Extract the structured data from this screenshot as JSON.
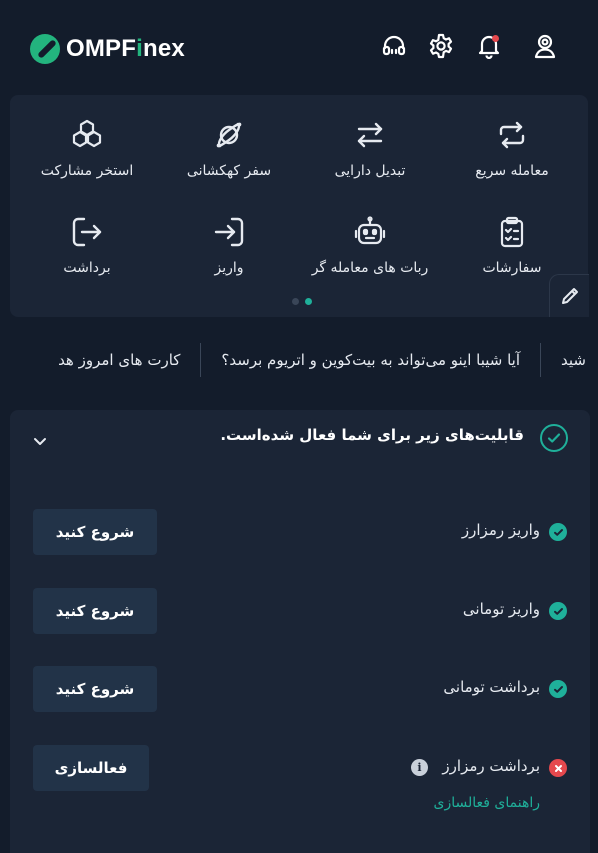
{
  "brand": {
    "name_main": "OMPF",
    "name_accent": "i",
    "name_tail": "nex",
    "accent_color": "#23b47e"
  },
  "header_icons": [
    "support-headset-icon",
    "settings-gear-icon",
    "notification-bell-icon",
    "user-profile-icon"
  ],
  "quick_actions": [
    {
      "label": "معامله سریع",
      "icon": "quick-trade-icon"
    },
    {
      "label": "تبدیل دارایی",
      "icon": "asset-convert-icon"
    },
    {
      "label": "سفر کهکشانی",
      "icon": "planet-icon"
    },
    {
      "label": "استخر مشارکت",
      "icon": "pool-cubes-icon"
    },
    {
      "label": "سفارشات",
      "icon": "orders-clipboard-icon"
    },
    {
      "label": "ربات های معامله گر",
      "icon": "robot-icon"
    },
    {
      "label": "واریز",
      "icon": "deposit-icon"
    },
    {
      "label": "برداشت",
      "icon": "withdraw-icon"
    }
  ],
  "carousel": {
    "pages": 2,
    "active": 2
  },
  "ticker": {
    "items": [
      "شید",
      "آیا شیبا اینو می‌تواند به بیت‌کوین و اتریوم برسد؟",
      "کارت های امروز هد"
    ]
  },
  "features": {
    "title": "قابلیت‌های زیر برای شما فعال شده‌است.",
    "rows": [
      {
        "label": "واریز رمزارز",
        "status": "ok",
        "button": "شروع کنید"
      },
      {
        "label": "واریز تومانی",
        "status": "ok",
        "button": "شروع کنید"
      },
      {
        "label": "برداشت تومانی",
        "status": "ok",
        "button": "شروع کنید"
      },
      {
        "label": "برداشت رمزارز",
        "status": "error",
        "button": "فعالسازی",
        "info": "i",
        "guide": "راهنمای فعالسازی"
      }
    ]
  },
  "colors": {
    "background": "#131c2b",
    "panel": "#1b2536",
    "button": "#223348",
    "success": "#1fb09a",
    "error": "#e5484d"
  }
}
